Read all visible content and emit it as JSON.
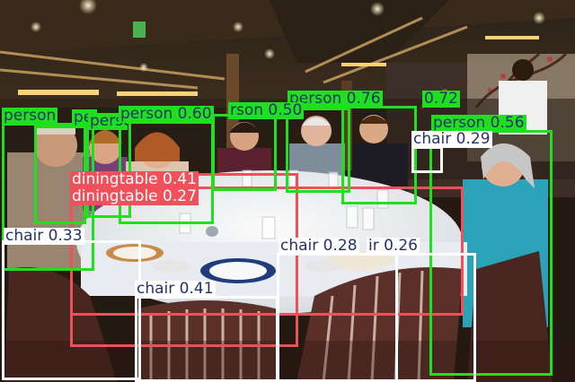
{
  "colors": {
    "person": "#1fe01f",
    "diningtable": "#f0505a",
    "chair": "#ffffff"
  },
  "detections": [
    {
      "label": "person 0.76",
      "cls": "person"
    },
    {
      "label": "0.72",
      "cls": "person"
    },
    {
      "label": "person",
      "cls": "person"
    },
    {
      "label": "person 0.56",
      "cls": "person"
    },
    {
      "label": "person",
      "cls": "person"
    },
    {
      "label": "person",
      "cls": "person"
    },
    {
      "label": "person 0.60",
      "cls": "person"
    },
    {
      "label": "rson 0.50",
      "cls": "person"
    },
    {
      "label": "chair 0.29",
      "cls": "chair"
    },
    {
      "label": "diningtable 0.41",
      "cls": "diningtable"
    },
    {
      "label": "diningtable 0.27",
      "cls": "diningtable"
    },
    {
      "label": "chair 0.33",
      "cls": "chair"
    },
    {
      "label": "chair 0.28",
      "cls": "chair"
    },
    {
      "label": "ir 0.26",
      "cls": "chair"
    },
    {
      "label": "chair 0.41",
      "cls": "chair"
    }
  ]
}
